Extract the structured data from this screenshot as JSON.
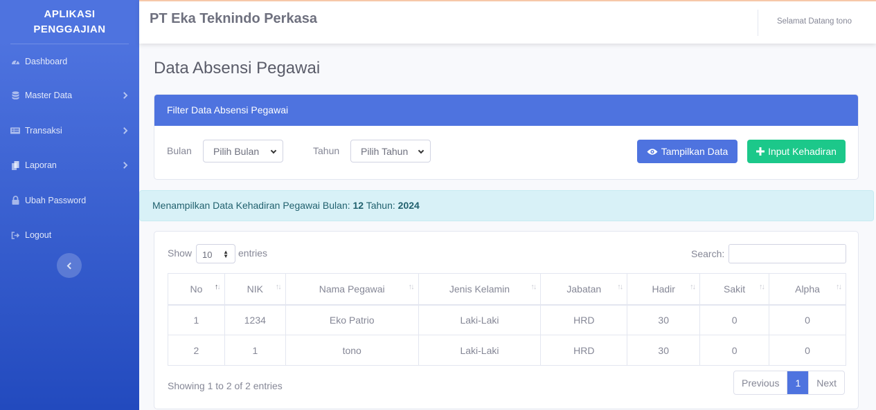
{
  "sidebar": {
    "brand_line1": "APLIKASI",
    "brand_line2": "PENGGAJIAN",
    "items": [
      {
        "label": "Dashboard",
        "icon": "tachometer-icon",
        "has_arrow": false
      },
      {
        "label": "Master Data",
        "icon": "database-icon",
        "has_arrow": true
      },
      {
        "label": "Transaksi",
        "icon": "list-icon",
        "has_arrow": true
      },
      {
        "label": "Laporan",
        "icon": "copy-icon",
        "has_arrow": true
      },
      {
        "label": "Ubah Password",
        "icon": "lock-icon",
        "has_arrow": false
      },
      {
        "label": "Logout",
        "icon": "sign-out-icon",
        "has_arrow": false
      }
    ]
  },
  "topbar": {
    "company": "PT Eka Teknindo Perkasa",
    "welcome": "Selamat Datang tono"
  },
  "page": {
    "title": "Data Absensi Pegawai"
  },
  "filter": {
    "header": "Filter Data Absensi Pegawai",
    "bulan_label": "Bulan",
    "bulan_value": "Pilih Bulan",
    "tahun_label": "Tahun",
    "tahun_value": "Pilih Tahun",
    "show_button": "Tampilkan Data",
    "input_button": "Input Kehadiran"
  },
  "alert": {
    "prefix": "Menampilkan Data Kehadiran Pegawai Bulan: ",
    "bulan": "12",
    "mid": " Tahun: ",
    "tahun": "2024"
  },
  "table": {
    "show_label": "Show",
    "length_value": "10",
    "entries_label": "entries",
    "search_label": "Search:",
    "columns": [
      "No",
      "NIK",
      "Nama Pegawai",
      "Jenis Kelamin",
      "Jabatan",
      "Hadir",
      "Sakit",
      "Alpha"
    ],
    "rows": [
      [
        "1",
        "1234",
        "Eko Patrio",
        "Laki-Laki",
        "HRD",
        "30",
        "0",
        "0"
      ],
      [
        "2",
        "1",
        "tono",
        "Laki-Laki",
        "HRD",
        "30",
        "0",
        "0"
      ]
    ],
    "info": "Showing 1 to 2 of 2 entries",
    "pager": {
      "previous": "Previous",
      "current": "1",
      "next": "Next"
    }
  },
  "colors": {
    "primary": "#4e73df",
    "success": "#1cc88a",
    "info_bg": "#d8f1f7"
  }
}
